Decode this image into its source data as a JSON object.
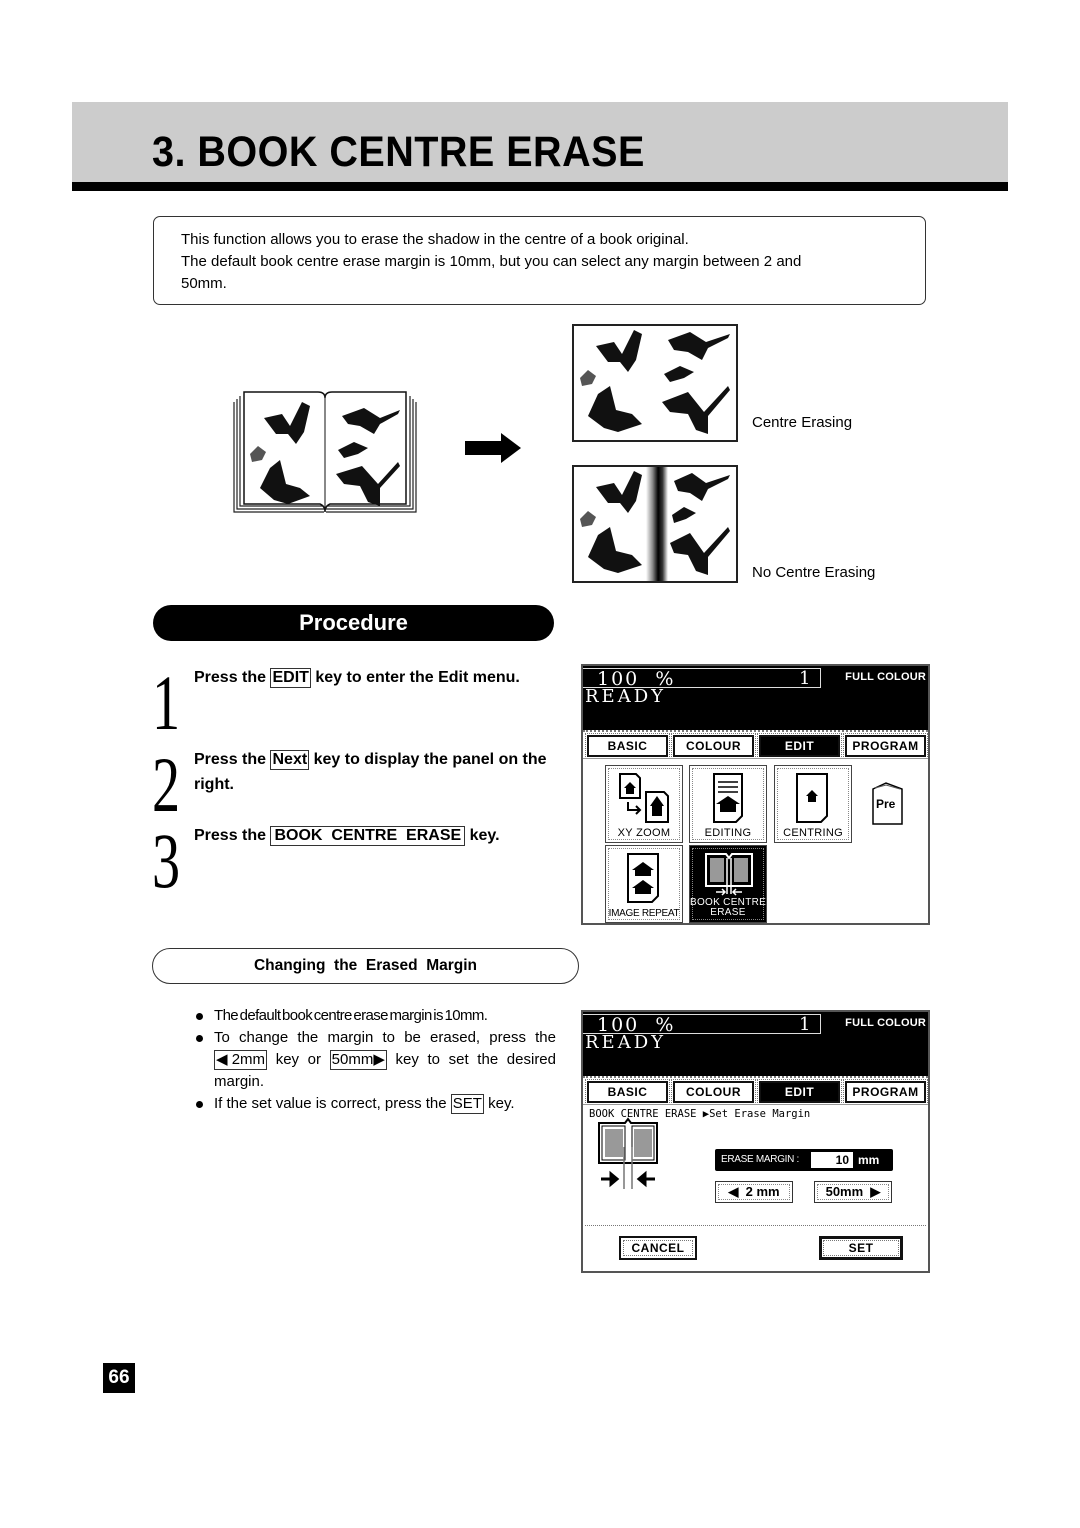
{
  "header": {
    "title": "3. BOOK  CENTRE  ERASE"
  },
  "intro": {
    "lines": [
      "This function allows you to erase the shadow in the centre of a book original.",
      "The default book centre erase margin is 10mm, but you can select any margin between 2 and",
      "50mm."
    ]
  },
  "illustration": {
    "source_icon": "open-book-with-butterflies-and-dragonflies",
    "arrow_icon": "right-arrow",
    "captions": {
      "centre_erasing": "Centre Erasing",
      "no_centre_erasing": "No Centre Erasing"
    }
  },
  "procedure": {
    "heading": "Procedure",
    "steps": [
      {
        "number": "1",
        "pre": "Press the ",
        "key": "EDIT",
        "post": " key to enter the Edit menu."
      },
      {
        "number": "2",
        "pre": "Press the ",
        "key": "Next",
        "post": " key to display the panel on the  right."
      },
      {
        "number": "3",
        "pre": "Press  the ",
        "key": "BOOK  CENTRE  ERASE",
        "post": " key."
      }
    ]
  },
  "changing_margin": {
    "heading": "Changing  the  Erased  Margin",
    "bullets": {
      "b1": "The default book centre erase margin is 10mm.",
      "b2_pre": "To change the margin to be erased,  press the ",
      "b2_key1": "◀ 2mm",
      "b2_mid": " key or ",
      "b2_key2": "50mm▶",
      "b2_post": " key to set the desired  margin.",
      "b3_pre": "If the set value is correct, press the ",
      "b3_key": "SET",
      "b3_post": " key."
    }
  },
  "screen1": {
    "zoom": "100  %",
    "count": "1",
    "mode": "FULL COLOUR",
    "status": "READY",
    "tabs": [
      "BASIC",
      "COLOUR",
      "EDIT",
      "PROGRAM"
    ],
    "active_tab": "EDIT",
    "functions": [
      {
        "label": "XY ZOOM",
        "icon": "xy-zoom-icon"
      },
      {
        "label": "EDITING",
        "icon": "editing-icon"
      },
      {
        "label": "CENTRING",
        "icon": "centring-icon"
      },
      {
        "label": "IMAGE REPEAT",
        "icon": "image-repeat-icon"
      },
      {
        "label_line1": "BOOK CENTRE",
        "label_line2": "ERASE",
        "icon": "book-centre-erase-icon",
        "selected": true
      }
    ],
    "pre_label": "Pre"
  },
  "screen2": {
    "zoom": "100  %",
    "count": "1",
    "mode": "FULL COLOUR",
    "status": "READY",
    "tabs": [
      "BASIC",
      "COLOUR",
      "EDIT",
      "PROGRAM"
    ],
    "active_tab": "EDIT",
    "breadcrumb": "BOOK CENTRE ERASE ▶Set Erase Margin",
    "erase_margin_label": "ERASE MARGIN :",
    "erase_margin_value": "10",
    "erase_margin_unit": "mm",
    "decrease_label": "◀  2 mm",
    "increase_label": "50mm  ▶",
    "cancel_label": "CANCEL",
    "set_label": "SET"
  },
  "footer": {
    "page_number": "66"
  }
}
